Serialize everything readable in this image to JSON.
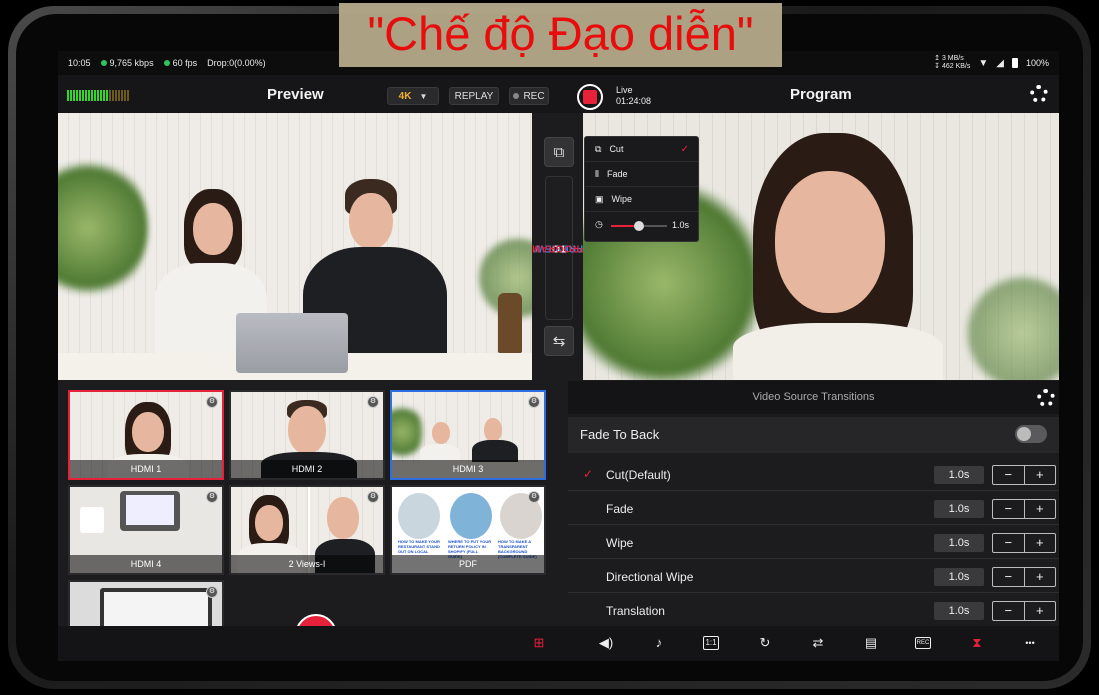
{
  "banner": {
    "text": "\"Chế độ Đạo diễn\""
  },
  "status": {
    "time": "10:05",
    "bitrate": "9,765 kbps",
    "fps": "60 fps",
    "drop": "Drop:0(0.00%)",
    "up": "↥ 3 MB/s",
    "down": "↧ 462 KB/s",
    "battery": "100%"
  },
  "header": {
    "preview_title": "Preview",
    "resolution": "4K",
    "replay": "REPLAY",
    "rec": "REC",
    "live_label": "Live",
    "live_time": "01:24:08",
    "program_title": "Program"
  },
  "side": {
    "preview_word": "PREVIEW",
    "to_word": "TO",
    "program_word": "PROGRAM"
  },
  "transition_menu": {
    "items": [
      {
        "label": "Cut",
        "checked": true
      },
      {
        "label": "Fade"
      },
      {
        "label": "Wipe"
      }
    ],
    "duration": "1.0s",
    "slider_fraction": 0.5
  },
  "sources": [
    {
      "label": "HDMI 1",
      "state": "program"
    },
    {
      "label": "HDMI 2"
    },
    {
      "label": "HDMI 3",
      "state": "preview"
    },
    {
      "label": "HDMI 4"
    },
    {
      "label": "2 Views-I"
    },
    {
      "label": "PDF"
    },
    {
      "label": ""
    }
  ],
  "pdf_cards": [
    "HOW TO MAKE YOUR RESTAURANT STAND OUT ON LOCAL",
    "WHERE TO PUT YOUR RETURN POLICY IN SHOPIFY (FULL GUIDE)",
    "HOW TO MAKE A TRANSPARENT BACKGROUND (COMPLETE GUIDE)"
  ],
  "panel": {
    "title": "Video Source Transitions",
    "fade_to_back": "Fade To Back",
    "fade_to_back_on": false,
    "transitions": [
      {
        "name": "Cut(Default)",
        "value": "1.0s",
        "selected": true
      },
      {
        "name": "Fade",
        "value": "1.0s"
      },
      {
        "name": "Wipe",
        "value": "1.0s"
      },
      {
        "name": "Directional Wipe",
        "value": "1.0s"
      },
      {
        "name": "Translation",
        "value": "1.0s"
      }
    ],
    "minus": "−",
    "plus": "+"
  },
  "toolbar": {
    "icons": [
      "layout-icon",
      "audio-icon",
      "music-icon",
      "aspect-icon",
      "replay-icon",
      "switch-camera-icon",
      "comment-icon",
      "rec-icon",
      "timer-icon",
      "more-icon"
    ],
    "aspect_text": "1:1",
    "rec_text": "REC",
    "more_text": "•••"
  },
  "colors": {
    "accent": "#e8213b",
    "preview_blue": "#2d6fe0",
    "bg": "#1c1c1e"
  }
}
